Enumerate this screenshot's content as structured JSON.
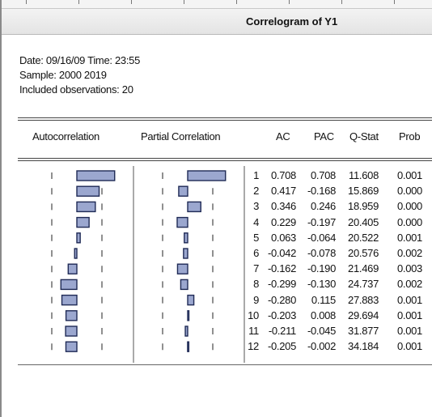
{
  "window": {
    "title": "Correlogram of Y1"
  },
  "info": {
    "date_line": "Date: 09/16/09   Time: 23:55",
    "sample_line": "Sample: 2000 2019",
    "obs_line": "Included observations: 20"
  },
  "columns": {
    "autocorrelation": "Autocorrelation",
    "partial_correlation": "Partial Correlation",
    "ac": "AC",
    "pac": "PAC",
    "qstat": "Q-Stat",
    "prob": "Prob"
  },
  "colors": {
    "bar_fill": "#9ba7cf",
    "bar_stroke": "#1f2a55",
    "text": "#111111"
  },
  "rows": [
    {
      "lag": "1",
      "ac": "0.708",
      "pac": "0.708",
      "q": "11.608",
      "prob": "0.001"
    },
    {
      "lag": "2",
      "ac": "0.417",
      "pac": "-0.168",
      "q": "15.869",
      "prob": "0.000"
    },
    {
      "lag": "3",
      "ac": "0.346",
      "pac": "0.246",
      "q": "18.959",
      "prob": "0.000"
    },
    {
      "lag": "4",
      "ac": "0.229",
      "pac": "-0.197",
      "q": "20.405",
      "prob": "0.000"
    },
    {
      "lag": "5",
      "ac": "0.063",
      "pac": "-0.064",
      "q": "20.522",
      "prob": "0.001"
    },
    {
      "lag": "6",
      "ac": "-0.042",
      "pac": "-0.078",
      "q": "20.576",
      "prob": "0.002"
    },
    {
      "lag": "7",
      "ac": "-0.162",
      "pac": "-0.190",
      "q": "21.469",
      "prob": "0.003"
    },
    {
      "lag": "8",
      "ac": "-0.299",
      "pac": "-0.130",
      "q": "24.737",
      "prob": "0.002"
    },
    {
      "lag": "9",
      "ac": "-0.280",
      "pac": "0.115",
      "q": "27.883",
      "prob": "0.001"
    },
    {
      "lag": "10",
      "ac": "-0.203",
      "pac": "0.008",
      "q": "29.694",
      "prob": "0.001"
    },
    {
      "lag": "11",
      "ac": "-0.211",
      "pac": "-0.045",
      "q": "31.877",
      "prob": "0.001"
    },
    {
      "lag": "12",
      "ac": "-0.205",
      "pac": "-0.002",
      "q": "34.184",
      "prob": "0.001"
    }
  ]
}
